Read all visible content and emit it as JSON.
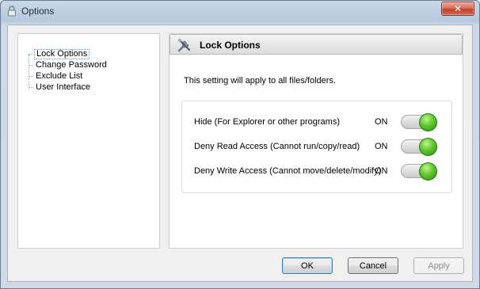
{
  "window": {
    "title": "Options",
    "close_glyph": "✕"
  },
  "tree": {
    "items": [
      {
        "label": "Lock Options",
        "selected": true
      },
      {
        "label": "Change Password",
        "selected": false
      },
      {
        "label": "Exclude List",
        "selected": false
      },
      {
        "label": "User Interface",
        "selected": false
      }
    ]
  },
  "panel": {
    "title": "Lock Options",
    "icon": "tools-icon",
    "note": "This setting will apply to all files/folders.",
    "settings": [
      {
        "label": "Hide (For Explorer or other programs)",
        "state": "ON",
        "enabled": true
      },
      {
        "label": "Deny Read Access (Cannot run/copy/read)",
        "state": "ON",
        "enabled": true
      },
      {
        "label": "Deny Write Access (Cannot move/delete/modify)",
        "state": "ON",
        "enabled": true
      }
    ]
  },
  "buttons": {
    "ok": "OK",
    "cancel": "Cancel",
    "apply": "Apply"
  },
  "colors": {
    "toggle_on": "#5fc72e",
    "close": "#c2412a",
    "default_button": "#3c7fb1"
  }
}
